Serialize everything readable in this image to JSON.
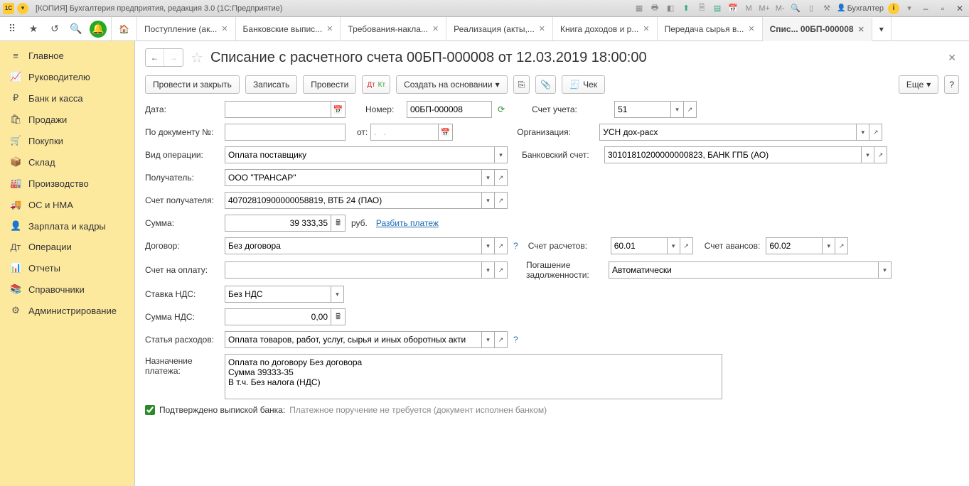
{
  "titlebar": {
    "title": "[КОПИЯ] Бухгалтерия предприятия, редакция 3.0  (1С:Предприятие)",
    "user": "Бухгалтер",
    "m_buttons": [
      "M",
      "M+",
      "M-"
    ]
  },
  "tabs": [
    {
      "label": "Поступление (ак..."
    },
    {
      "label": "Банковские выпис..."
    },
    {
      "label": "Требования-накла..."
    },
    {
      "label": "Реализация (акты,..."
    },
    {
      "label": "Книга доходов и р..."
    },
    {
      "label": "Передача сырья в..."
    },
    {
      "label": "Спис... 00БП-000008"
    }
  ],
  "sidebar": [
    {
      "icon": "≡",
      "label": "Главное"
    },
    {
      "icon": "📈",
      "label": "Руководителю"
    },
    {
      "icon": "₽",
      "label": "Банк и касса"
    },
    {
      "icon": "🛍",
      "label": "Продажи"
    },
    {
      "icon": "🛒",
      "label": "Покупки"
    },
    {
      "icon": "📦",
      "label": "Склад"
    },
    {
      "icon": "🏭",
      "label": "Производство"
    },
    {
      "icon": "🚚",
      "label": "ОС и НМА"
    },
    {
      "icon": "👤",
      "label": "Зарплата и кадры"
    },
    {
      "icon": "Дт",
      "label": "Операции"
    },
    {
      "icon": "📊",
      "label": "Отчеты"
    },
    {
      "icon": "📚",
      "label": "Справочники"
    },
    {
      "icon": "⚙",
      "label": "Администрирование"
    }
  ],
  "doc": {
    "title": "Списание с расчетного счета 00БП-000008 от 12.03.2019 18:00:00"
  },
  "toolbar": {
    "post_close": "Провести и закрыть",
    "save": "Записать",
    "post": "Провести",
    "based_on": "Создать на основании",
    "check": "Чек",
    "more": "Еще"
  },
  "labels": {
    "date": "Дата:",
    "number": "Номер:",
    "account": "Счет учета:",
    "by_doc": "По документу №:",
    "from": "от:",
    "dot_date": ".   .",
    "org": "Организация:",
    "op_type": "Вид операции:",
    "bank_acc": "Банковский счет:",
    "recipient": "Получатель:",
    "rec_account": "Счет получателя:",
    "amount": "Сумма:",
    "currency": "руб.",
    "split": "Разбить платеж",
    "contract": "Договор:",
    "settle_acc": "Счет расчетов:",
    "advance_acc": "Счет авансов:",
    "invoice": "Счет на оплату:",
    "debt": "Погашение задолженности:",
    "vat_rate": "Ставка НДС:",
    "vat_amount": "Сумма НДС:",
    "expense_item": "Статья расходов:",
    "purpose": "Назначение платежа:",
    "confirmed": "Подтверждено выпиской банка:",
    "confirm_note": "Платежное поручение не требуется (документ исполнен банком)"
  },
  "values": {
    "date": "12.03.2019 18:00:00",
    "number": "00БП-000008",
    "account": "51",
    "org": "УСН дох-расх",
    "op_type": "Оплата поставщику",
    "bank_acc": "30101810200000000823, БАНК ГПБ (АО)",
    "recipient": "ООО \"ТРАНСАР\"",
    "rec_account": "40702810900000058819, ВТБ 24 (ПАО)",
    "amount": "39 333,35",
    "contract": "Без договора",
    "settle_acc": "60.01",
    "advance_acc": "60.02",
    "debt": "Автоматически",
    "vat_rate": "Без НДС",
    "vat_amount": "0,00",
    "expense_item": "Оплата товаров, работ, услуг, сырья и иных оборотных акти",
    "purpose": "Оплата по договору Без договора\nСумма 39333-35\nВ т.ч. Без налога (НДС)"
  }
}
